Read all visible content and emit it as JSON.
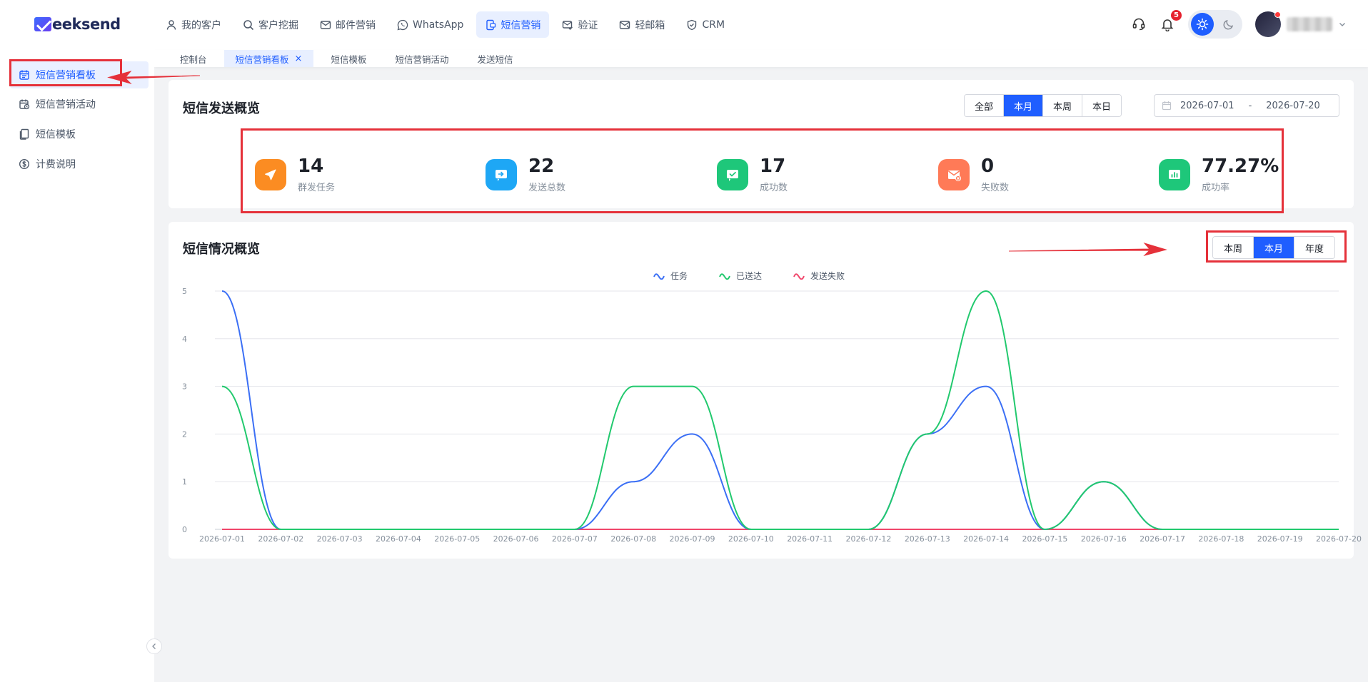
{
  "logo": {
    "text": "eeksend"
  },
  "nav": [
    {
      "label": "我的客户",
      "icon": "user-icon",
      "active": false
    },
    {
      "label": "客户挖掘",
      "icon": "search-icon",
      "active": false
    },
    {
      "label": "邮件营销",
      "icon": "mail-icon",
      "active": false
    },
    {
      "label": "WhatsApp",
      "icon": "whatsapp-icon",
      "active": false
    },
    {
      "label": "短信营销",
      "icon": "sms-icon",
      "active": true
    },
    {
      "label": "验证",
      "icon": "verify-mail-icon",
      "active": false
    },
    {
      "label": "轻邮箱",
      "icon": "light-mail-icon",
      "active": false
    },
    {
      "label": "CRM",
      "icon": "shield-icon",
      "active": false
    }
  ],
  "notifications": {
    "count": "5"
  },
  "subtabs": [
    {
      "label": "控制台",
      "active": false
    },
    {
      "label": "短信营销看板",
      "active": true,
      "close": "×"
    },
    {
      "label": "短信模板",
      "active": false
    },
    {
      "label": "短信营销活动",
      "active": false
    },
    {
      "label": "发送短信",
      "active": false
    }
  ],
  "sidebar": [
    {
      "label": "短信营销看板",
      "icon": "calendar-icon",
      "active": true
    },
    {
      "label": "短信营销活动",
      "icon": "calendar-clock-icon",
      "active": false
    },
    {
      "label": "短信模板",
      "icon": "copy-icon",
      "active": false
    },
    {
      "label": "计费说明",
      "icon": "dollar-icon",
      "active": false
    }
  ],
  "overview": {
    "title": "短信发送概览",
    "range_buttons": [
      {
        "label": "全部",
        "active": false
      },
      {
        "label": "本月",
        "active": true
      },
      {
        "label": "本周",
        "active": false
      },
      {
        "label": "本日",
        "active": false
      }
    ],
    "date_start": "2026-07-01",
    "date_sep": "-",
    "date_end": "2026-07-20",
    "stats": [
      {
        "value": "14",
        "label": "群发任务",
        "icon": "send-icon",
        "color": "#fb8c22"
      },
      {
        "value": "22",
        "label": "发送总数",
        "icon": "forward-icon",
        "color": "#1ea7f5"
      },
      {
        "value": "17",
        "label": "成功数",
        "icon": "success-chat-icon",
        "color": "#1ec77a"
      },
      {
        "value": "0",
        "label": "失败数",
        "icon": "fail-mail-icon",
        "color": "#ff7a57"
      },
      {
        "value": "77.27%",
        "label": "成功率",
        "icon": "bar-chart-icon",
        "color": "#1ec77a"
      }
    ]
  },
  "situation": {
    "title": "短信情况概览",
    "range_buttons": [
      {
        "label": "本周",
        "active": false
      },
      {
        "label": "本月",
        "active": true
      },
      {
        "label": "年度",
        "active": false
      }
    ]
  },
  "chart_data": {
    "type": "line",
    "categories": [
      "2026-07-01",
      "2026-07-02",
      "2026-07-03",
      "2026-07-04",
      "2026-07-05",
      "2026-07-06",
      "2026-07-07",
      "2026-07-08",
      "2026-07-09",
      "2026-07-10",
      "2026-07-11",
      "2026-07-12",
      "2026-07-13",
      "2026-07-14",
      "2026-07-15",
      "2026-07-16",
      "2026-07-17",
      "2026-07-18",
      "2026-07-19",
      "2026-07-20"
    ],
    "series": [
      {
        "name": "任务",
        "color": "#3b6ff5",
        "values": [
          5,
          0,
          0,
          0,
          0,
          0,
          0,
          1,
          2,
          0,
          0,
          0,
          2,
          3,
          0,
          1,
          0,
          0,
          0,
          0
        ]
      },
      {
        "name": "已送达",
        "color": "#22c96e",
        "values": [
          3,
          0,
          0,
          0,
          0,
          0,
          0,
          3,
          3,
          0,
          0,
          0,
          2,
          5,
          0,
          1,
          0,
          0,
          0,
          0
        ]
      },
      {
        "name": "发送失败",
        "color": "#f0466b",
        "values": [
          0,
          0,
          0,
          0,
          0,
          0,
          0,
          0,
          0,
          0,
          0,
          0,
          0,
          0,
          0,
          0,
          0,
          0,
          0,
          0
        ]
      }
    ],
    "ylim": [
      0,
      5
    ],
    "yticks": [
      0,
      1,
      2,
      3,
      4,
      5
    ],
    "grid": true,
    "legend": "top-center"
  }
}
